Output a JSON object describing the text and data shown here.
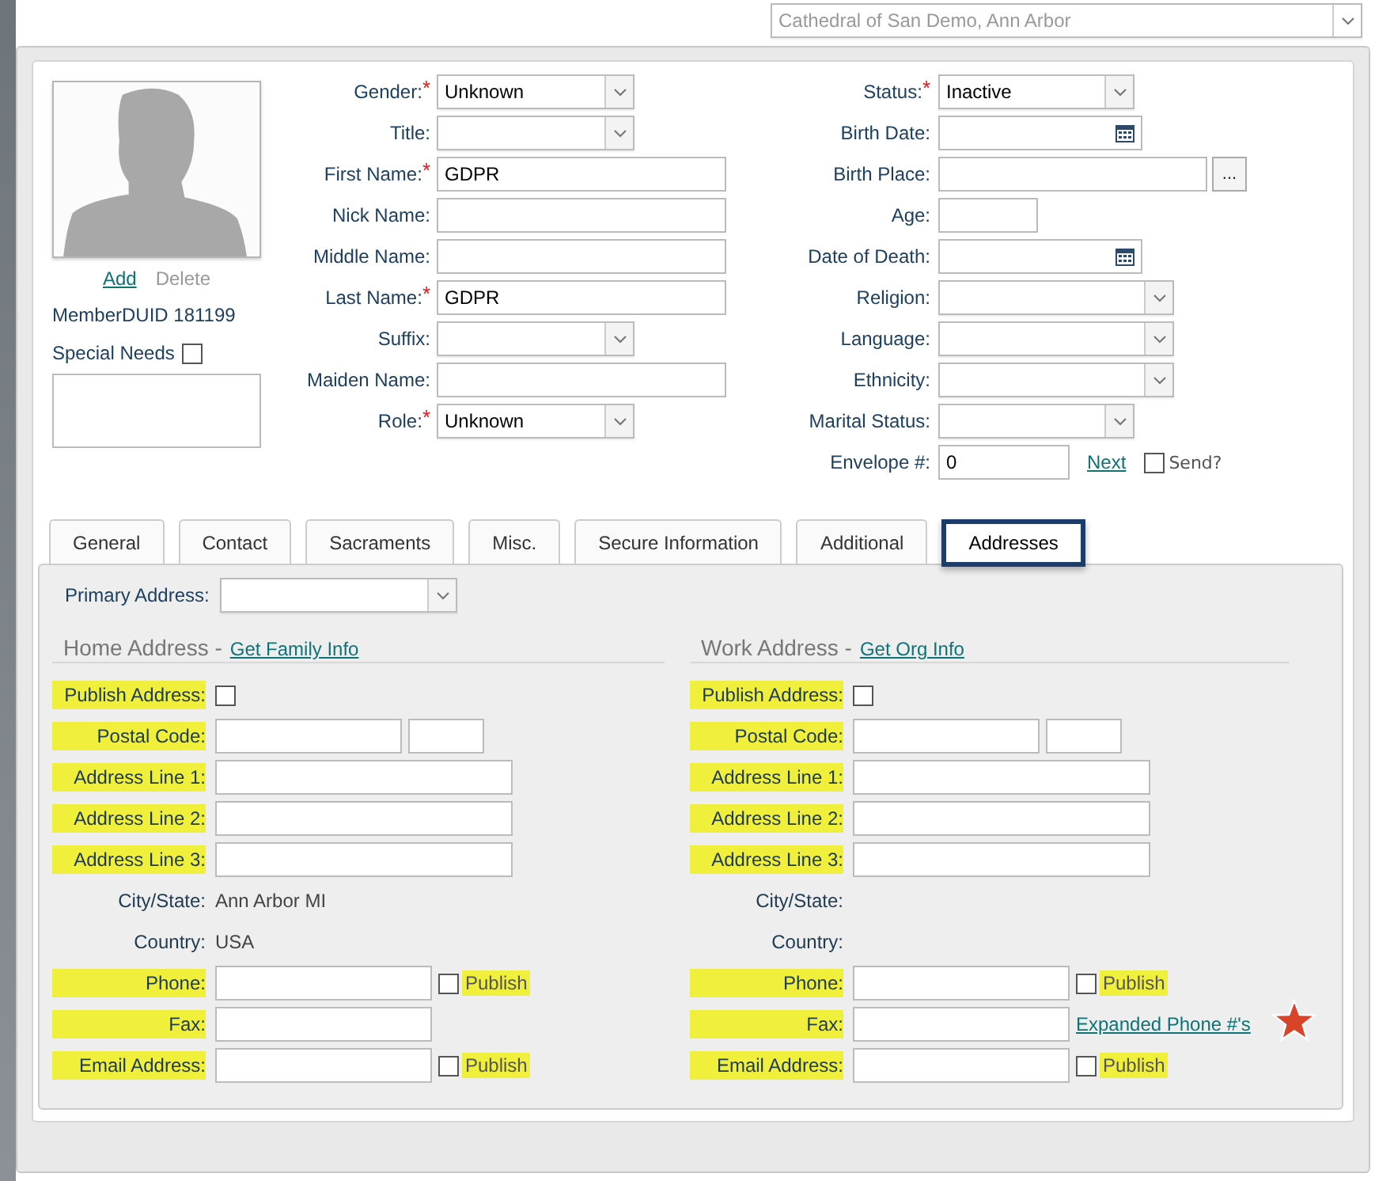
{
  "site_select": {
    "value": "Cathedral of San Demo, Ann Arbor",
    "disabled": true
  },
  "photo": {
    "actions": [
      {
        "label": "Add",
        "disabled": false
      },
      {
        "label": "Delete",
        "disabled": true
      }
    ],
    "member_id": "MemberDUID 181199"
  },
  "special_needs": {
    "label": "Special Needs",
    "checked": false
  },
  "left_fields": [
    {
      "label": "Gender:",
      "required_mark": "*",
      "kind": "select",
      "value": "Unknown"
    },
    {
      "label": "Title:",
      "kind": "select"
    },
    {
      "label": "First Name:",
      "required_mark": "*",
      "kind": "text",
      "value": "GDPR"
    },
    {
      "label": "Nick Name:",
      "kind": "text"
    },
    {
      "label": "Middle Name:",
      "kind": "text"
    },
    {
      "label": "Last Name:",
      "required_mark": "*",
      "kind": "text",
      "value": "GDPR"
    },
    {
      "label": "Suffix:",
      "kind": "select"
    },
    {
      "label": "Maiden Name:",
      "kind": "text"
    },
    {
      "label": "Role:",
      "required_mark": "*",
      "kind": "select",
      "value": "Unknown"
    }
  ],
  "right_fields": [
    {
      "label": "Status:",
      "required_mark": "*",
      "kind": "select",
      "value": "Inactive"
    },
    {
      "label": "Birth Date:",
      "kind": "date"
    },
    {
      "label": "Birth Place:",
      "kind": "text-button",
      "button": "..."
    },
    {
      "label": "Age:",
      "kind": "short"
    },
    {
      "label": "Date of Death:",
      "kind": "date"
    },
    {
      "label": "Religion:",
      "kind": "select-wide"
    },
    {
      "label": "Language:",
      "kind": "select-wide"
    },
    {
      "label": "Ethnicity:",
      "kind": "select-wide"
    },
    {
      "label": "Marital Status:",
      "kind": "select"
    },
    {
      "label": "Envelope #:",
      "kind": "envelope",
      "value": "0",
      "link": "Next",
      "check_label": "Send?",
      "checked": false
    }
  ],
  "tabs": [
    {
      "label": "General",
      "selected": false
    },
    {
      "label": "Contact",
      "selected": false
    },
    {
      "label": "Sacraments",
      "selected": false
    },
    {
      "label": "Misc.",
      "selected": false
    },
    {
      "label": "Secure Information",
      "selected": false
    },
    {
      "label": "Additional",
      "selected": false
    },
    {
      "label": "Addresses",
      "selected": true
    }
  ],
  "primary_address": {
    "label": "Primary Address:"
  },
  "sections": [
    {
      "title": "Home Address -",
      "link": "Get Family Info",
      "rows": [
        {
          "label": "Publish Address:",
          "highlighted": true,
          "kind": "checkbox",
          "checked": false
        },
        {
          "label": "Postal Code:",
          "highlighted": true,
          "kind": "postal"
        },
        {
          "label": "Address Line 1:",
          "highlighted": true,
          "kind": "text"
        },
        {
          "label": "Address Line 2:",
          "highlighted": true,
          "kind": "text"
        },
        {
          "label": "Address Line 3:",
          "highlighted": true,
          "kind": "text"
        },
        {
          "label": "City/State:",
          "highlighted": false,
          "kind": "static",
          "value": "Ann Arbor MI"
        },
        {
          "label": "Country:",
          "highlighted": false,
          "kind": "static",
          "value": "USA"
        },
        {
          "label": "Phone:",
          "highlighted": true,
          "kind": "phone",
          "publish": {
            "label": "Publish",
            "checked": false
          }
        },
        {
          "label": "Fax:",
          "highlighted": true,
          "kind": "phone"
        },
        {
          "label": "Email Address:",
          "highlighted": true,
          "kind": "phone",
          "publish": {
            "label": "Publish",
            "checked": false
          }
        }
      ]
    },
    {
      "title": "Work Address -",
      "link": "Get Org Info",
      "rows": [
        {
          "label": "Publish Address:",
          "highlighted": true,
          "kind": "checkbox",
          "checked": false
        },
        {
          "label": "Postal Code:",
          "highlighted": true,
          "kind": "postal"
        },
        {
          "label": "Address Line 1:",
          "highlighted": true,
          "kind": "text"
        },
        {
          "label": "Address Line 2:",
          "highlighted": true,
          "kind": "text"
        },
        {
          "label": "Address Line 3:",
          "highlighted": true,
          "kind": "text"
        },
        {
          "label": "City/State:",
          "highlighted": false,
          "kind": "static"
        },
        {
          "label": "Country:",
          "highlighted": false,
          "kind": "static"
        },
        {
          "label": "Phone:",
          "highlighted": true,
          "kind": "phone",
          "publish": {
            "label": "Publish",
            "checked": false
          }
        },
        {
          "label": "Fax:",
          "highlighted": true,
          "kind": "phone",
          "link": "Expanded Phone #'s",
          "starred": true
        },
        {
          "label": "Email Address:",
          "highlighted": true,
          "kind": "phone",
          "publish": {
            "label": "Publish",
            "checked": false
          }
        }
      ]
    }
  ]
}
